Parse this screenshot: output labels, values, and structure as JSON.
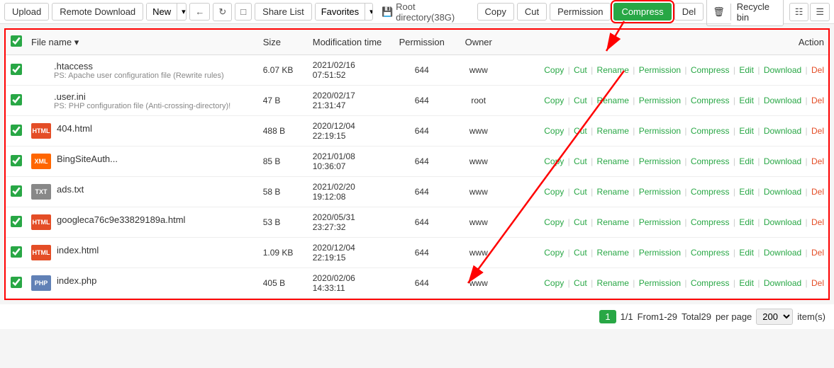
{
  "toolbar": {
    "upload": "Upload",
    "remote_download": "Remote Download",
    "new": "New",
    "share_list": "Share List",
    "favorites": "Favorites",
    "root_dir": "Root directory(38G)",
    "copy": "Copy",
    "cut": "Cut",
    "permission": "Permission",
    "compress": "Compress",
    "del": "Del",
    "recycle_bin": "Recycle bin"
  },
  "table": {
    "headers": {
      "filename": "File name",
      "size": "Size",
      "mod_time": "Modification time",
      "permission": "Permission",
      "owner": "Owner",
      "action": "Action"
    },
    "rows": [
      {
        "checked": true,
        "icon_type": "dot",
        "icon_label": "",
        "name": ".htaccess",
        "desc": "PS: Apache user configuration file (Rewrite rules)",
        "size": "6.07 KB",
        "mod_time": "2021/02/16\n07:51:52",
        "permission": "644",
        "owner": "www",
        "actions": [
          "Copy",
          "Cut",
          "Rename",
          "Permission",
          "Compress",
          "Edit",
          "Download",
          "Del"
        ]
      },
      {
        "checked": true,
        "icon_type": "dot",
        "icon_label": "",
        "name": ".user.ini",
        "desc": "PS: PHP configuration file (Anti-crossing-directory)!",
        "size": "47 B",
        "mod_time": "2020/02/17\n21:31:47",
        "permission": "644",
        "owner": "root",
        "actions": [
          "Copy",
          "Cut",
          "Rename",
          "Permission",
          "Compress",
          "Edit",
          "Download",
          "Del"
        ]
      },
      {
        "checked": true,
        "icon_type": "html",
        "icon_label": "HTML",
        "name": "404.html",
        "desc": "",
        "size": "488 B",
        "mod_time": "2020/12/04\n22:19:15",
        "permission": "644",
        "owner": "www",
        "actions": [
          "Copy",
          "Cut",
          "Rename",
          "Permission",
          "Compress",
          "Edit",
          "Download",
          "Del"
        ]
      },
      {
        "checked": true,
        "icon_type": "xml",
        "icon_label": "XML",
        "name": "BingSiteAuth...",
        "desc": "",
        "size": "85 B",
        "mod_time": "2021/01/08\n10:36:07",
        "permission": "644",
        "owner": "www",
        "actions": [
          "Copy",
          "Cut",
          "Rename",
          "Permission",
          "Compress",
          "Edit",
          "Download",
          "Del"
        ]
      },
      {
        "checked": true,
        "icon_type": "txt",
        "icon_label": "TXT",
        "name": "ads.txt",
        "desc": "",
        "size": "58 B",
        "mod_time": "2021/02/20\n19:12:08",
        "permission": "644",
        "owner": "www",
        "actions": [
          "Copy",
          "Cut",
          "Rename",
          "Permission",
          "Compress",
          "Edit",
          "Download",
          "Del"
        ]
      },
      {
        "checked": true,
        "icon_type": "html",
        "icon_label": "HTML",
        "name": "googleca76c9e33829189a.html",
        "desc": "",
        "size": "53 B",
        "mod_time": "2020/05/31\n23:27:32",
        "permission": "644",
        "owner": "www",
        "actions": [
          "Copy",
          "Cut",
          "Rename",
          "Permission",
          "Compress",
          "Edit",
          "Download",
          "Del"
        ]
      },
      {
        "checked": true,
        "icon_type": "html",
        "icon_label": "HTML",
        "name": "index.html",
        "desc": "",
        "size": "1.09 KB",
        "mod_time": "2020/12/04\n22:19:15",
        "permission": "644",
        "owner": "www",
        "actions": [
          "Copy",
          "Cut",
          "Rename",
          "Permission",
          "Compress",
          "Edit",
          "Download",
          "Del"
        ]
      },
      {
        "checked": true,
        "icon_type": "php",
        "icon_label": "PHP",
        "name": "index.php",
        "desc": "",
        "size": "405 B",
        "mod_time": "2020/02/06\n14:33:11",
        "permission": "644",
        "owner": "www",
        "actions": [
          "Copy",
          "Cut",
          "Rename",
          "Permission",
          "Compress",
          "Edit",
          "Download",
          "Del"
        ]
      }
    ]
  },
  "footer": {
    "page": "1",
    "total_pages": "1/1",
    "from_to": "From1-29",
    "total": "Total29",
    "per_page_label": "per page",
    "per_page_value": "200",
    "items_label": "item(s)"
  }
}
